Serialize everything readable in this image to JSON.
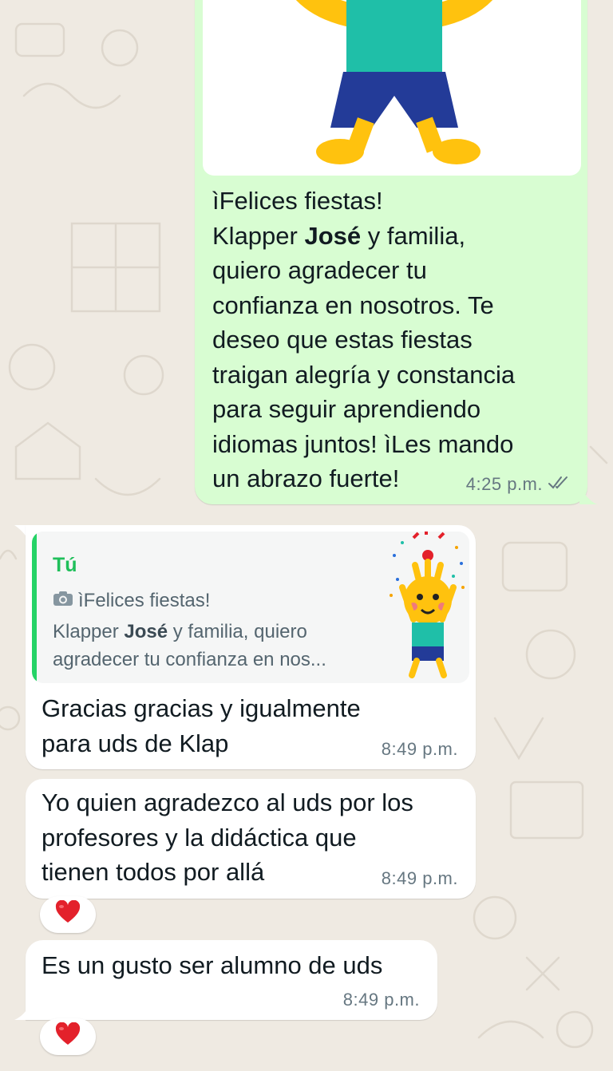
{
  "colors": {
    "outgoing_bubble": "#d8fdd2",
    "incoming_bubble": "#ffffff",
    "background": "#efeae2",
    "quote_accent": "#25d366",
    "read_ticks": "#667781",
    "heart": "#e3212b"
  },
  "outgoing": {
    "sticker": "kids-mascot-sticker",
    "text_lines": [
      "ìFelices fiestas!",
      "Klapper ",
      "José",
      " y familia,",
      "quiero agradecer tu",
      "confianza en nosotros. Te",
      "deseo que estas fiestas",
      "traigan alegría y constancia",
      "para seguir aprendiendo",
      "idiomas juntos! ìLes mando",
      "un abrazo fuerte!"
    ],
    "time": "4:25 p.m.",
    "status_icon": "double-check-icon"
  },
  "reply": {
    "quote_author": "Tú",
    "quote_icon": "camera-icon",
    "quote_line1": "ìFelices fiestas!",
    "quote_line2_pre": "Klapper ",
    "quote_line2_bold": "José",
    "quote_line2_post": " y familia, quiero",
    "quote_line3": "agradecer tu confianza en nos...",
    "text_line1": "Gracias gracias y igualmente",
    "text_line2": "para uds de Klap",
    "time": "8:49 p.m."
  },
  "message2": {
    "text_line1": "Yo quien agradezco al uds por los",
    "text_line2": "profesores y la didáctica que",
    "text_line3": "tienen todos por allá",
    "time": "8:49 p.m.",
    "reaction": "❤️"
  },
  "message3": {
    "text": "Es un gusto ser alumno de uds",
    "time": "8:49 p.m.",
    "reaction": "❤️"
  }
}
